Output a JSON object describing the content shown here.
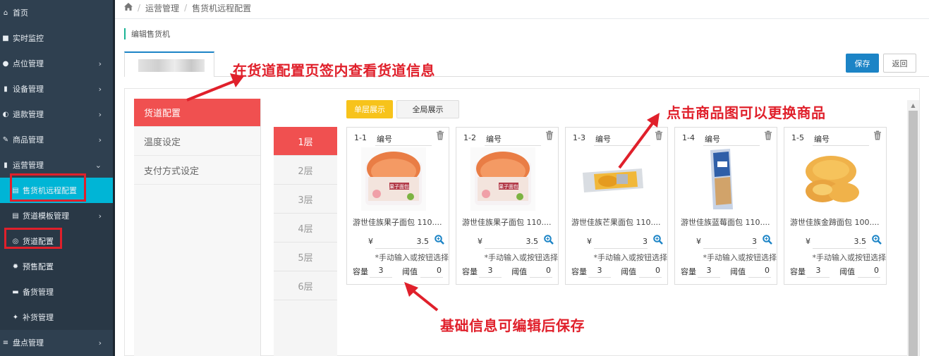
{
  "sidebar": {
    "items": [
      {
        "label": "首页",
        "icon": "home-icon",
        "has_children": false
      },
      {
        "label": "实时监控",
        "icon": "video-icon",
        "has_children": false
      },
      {
        "label": "点位管理",
        "icon": "map-pin-icon",
        "has_children": true
      },
      {
        "label": "设备管理",
        "icon": "device-icon",
        "has_children": true
      },
      {
        "label": "退款管理",
        "icon": "refund-icon",
        "has_children": true
      },
      {
        "label": "商品管理",
        "icon": "edit-icon",
        "has_children": true
      },
      {
        "label": "运营管理",
        "icon": "bookmark-icon",
        "has_children": true,
        "expanded": true
      },
      {
        "label": "售货机远程配置",
        "icon": "book-icon",
        "sub": true,
        "active": true
      },
      {
        "label": "货道模板管理",
        "icon": "file-icon",
        "sub": true,
        "has_children": true
      },
      {
        "label": "货道配置",
        "icon": "lifebuoy-icon",
        "sub": true
      },
      {
        "label": "预售配置",
        "icon": "gear-icon",
        "sub": true
      },
      {
        "label": "备货管理",
        "icon": "inbox-icon",
        "sub": true
      },
      {
        "label": "补货管理",
        "icon": "wrench-icon",
        "sub": true
      },
      {
        "label": "盘点管理",
        "icon": "list-icon",
        "has_children": true
      }
    ],
    "chevron_right": "›",
    "chevron_down": "⌄"
  },
  "breadcrumb": {
    "home_icon": "home-icon",
    "items": [
      "运营管理",
      "售货机远程配置"
    ],
    "separator": "/"
  },
  "section_title": "编辑售货机",
  "toolbar": {
    "save_label": "保存",
    "back_label": "返回"
  },
  "left_nav": {
    "items": [
      "货道配置",
      "温度设定",
      "支付方式设定"
    ],
    "active_index": 0
  },
  "floors": {
    "items": [
      "1层",
      "2层",
      "3层",
      "4层",
      "5层",
      "6层"
    ],
    "active_index": 0
  },
  "view_toggle": {
    "single_label": "单层展示",
    "all_label": "全局展示"
  },
  "slots": [
    {
      "id": "1-1",
      "num_label": "编号",
      "name": "游世佳族果子面包 110....",
      "currency": "¥",
      "price": "3.5",
      "hint": "*手动输入或按钮选择",
      "capacity_label": "容量",
      "capacity": "3",
      "threshold_label": "阈值",
      "threshold": "0"
    },
    {
      "id": "1-2",
      "num_label": "编号",
      "name": "游世佳族果子面包 110....",
      "currency": "¥",
      "price": "3.5",
      "hint": "*手动输入或按钮选择",
      "capacity_label": "容量",
      "capacity": "3",
      "threshold_label": "阈值",
      "threshold": "0"
    },
    {
      "id": "1-3",
      "num_label": "编号",
      "name": "游世佳族芒果面包 110....",
      "currency": "¥",
      "price": "3",
      "hint": "*手动输入或按钮选择",
      "capacity_label": "容量",
      "capacity": "3",
      "threshold_label": "阈值",
      "threshold": "0"
    },
    {
      "id": "1-4",
      "num_label": "编号",
      "name": "游世佳族蓝莓面包 110....",
      "currency": "¥",
      "price": "3",
      "hint": "*手动输入或按钮选择",
      "capacity_label": "容量",
      "capacity": "3",
      "threshold_label": "阈值",
      "threshold": "0"
    },
    {
      "id": "1-5",
      "num_label": "编号",
      "name": "游世佳族金蹄面包 100....",
      "currency": "¥",
      "price": "3.5",
      "hint": "*手动输入或按钮选择",
      "capacity_label": "容量",
      "capacity": "3",
      "threshold_label": "阈值",
      "threshold": "0"
    }
  ],
  "annotations": {
    "tab_hint": "在货道配置页签内查看货道信息",
    "image_hint": "点击商品图可以更换商品",
    "edit_hint": "基础信息可编辑后保存"
  },
  "colors": {
    "sidebar_bg": "#2f4050",
    "sidebar_active": "#00b5d6",
    "primary": "#1c84c6",
    "danger": "#f05050",
    "warning": "#f7c31b",
    "annotation_red": "#e0202b",
    "zoom_icon": "#1c84c6"
  }
}
